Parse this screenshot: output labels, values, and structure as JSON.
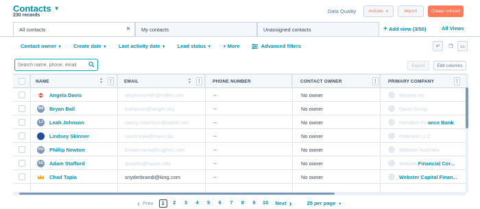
{
  "header": {
    "title": "Contacts",
    "records": "230 records",
    "data_quality": "Data Quality",
    "actions_label": "Actions",
    "import_label": "Import",
    "create_label": "Create contact"
  },
  "views": {
    "tabs": [
      {
        "label": "All contacts"
      },
      {
        "label": "My contacts"
      },
      {
        "label": "Unassigned contacts"
      }
    ],
    "add_view": "Add view (3/50)",
    "all_views": "All Views"
  },
  "filters": {
    "contact_owner": "Contact owner",
    "create_date": "Create date",
    "last_activity": "Last activity date",
    "lead_status": "Lead status",
    "more": "More",
    "advanced": "Advanced filters"
  },
  "search": {
    "placeholder": "Search name, phone, email"
  },
  "toolbar": {
    "export": "Export",
    "edit_columns": "Edit columns"
  },
  "table": {
    "columns": [
      "NAME",
      "EMAIL",
      "PHONE NUMBER",
      "CONTACT OWNER",
      "PRIMARY COMPANY"
    ],
    "rows": [
      {
        "initials": "",
        "logo": "red",
        "name": "Angela Davis",
        "email_prefix": "stephensmith@miller.com",
        "email_vis": "",
        "phone": "--",
        "owner": "No owner",
        "company": "",
        "company_blur": "Moreno Inc"
      },
      {
        "initials": "BB",
        "logo": "",
        "name": "Bryan Ball",
        "email_prefix": "ksimpson@wright.org",
        "email_vis": "",
        "phone": "--",
        "owner": "No owner",
        "company": "",
        "company_blur": "Davis Group"
      },
      {
        "initials": "LJ",
        "logo": "",
        "name": "Leah Johnson",
        "email_prefix": "nancy.robertson@walsh.net",
        "email_vis": "",
        "phone": "--",
        "owner": "No owner",
        "company": "ance Bank",
        "company_blur": "Hamilton Fin"
      },
      {
        "initials": "",
        "logo": "blue",
        "name": "Lindsey Skinner",
        "email_prefix": "courtneyw@reyes.biz",
        "email_vis": "",
        "phone": "--",
        "owner": "No owner",
        "company": "",
        "company_blur": "Peterson LLC"
      },
      {
        "initials": "PN",
        "logo": "",
        "name": "Phillip Newton",
        "email_prefix": "brownmaria@hughes.com",
        "email_vis": "",
        "phone": "--",
        "owner": "No owner",
        "company": "",
        "company_blur": "Webster Australia"
      },
      {
        "initials": "AS",
        "logo": "",
        "name": "Adam Stafford",
        "email_prefix": "qmartin@hayes.info",
        "email_vis": "",
        "phone": "--",
        "owner": "No owner",
        "company": "Financial Cor...",
        "company_blur": "Webster "
      },
      {
        "initials": "",
        "logo": "crown",
        "name": "Chad Tapia",
        "email_prefix": "",
        "email_vis": "snyderbrandi@king.com",
        "phone": "--",
        "owner": "No owner",
        "company": "Webster Capital Finan...",
        "company_blur": ""
      }
    ]
  },
  "pagination": {
    "prev": "Prev",
    "pages": [
      "1",
      "2",
      "3",
      "4",
      "5",
      "6",
      "7",
      "8",
      "9",
      "10"
    ],
    "next": "Next",
    "per_page": "25 per page"
  },
  "colors": {
    "accent": "#0091ae",
    "primary_button": "#ff7a59",
    "text": "#33475b"
  }
}
